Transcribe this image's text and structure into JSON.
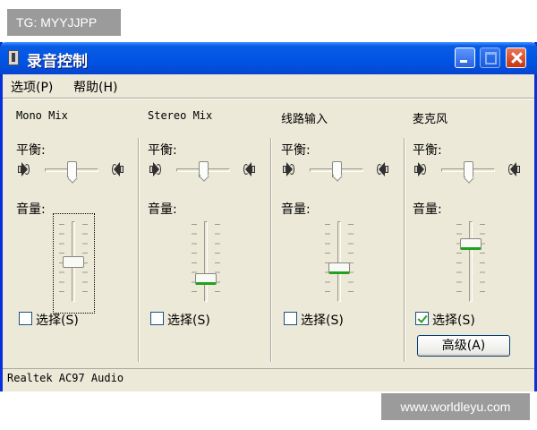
{
  "watermarks": {
    "top": "TG: MYYJJPP",
    "bottom": "www.worldleyu.com"
  },
  "window": {
    "title": "录音控制",
    "controls": [
      "minimize",
      "maximize",
      "close"
    ]
  },
  "menu": [
    {
      "label": "选项(P)"
    },
    {
      "label": "帮助(H)"
    }
  ],
  "labels": {
    "balance": "平衡:",
    "volume": "音量:",
    "select": "选择(S)",
    "advanced": "高级(A)"
  },
  "channels": [
    {
      "name": "Mono Mix",
      "balance": 0.5,
      "volume": 0.5,
      "selected": false
    },
    {
      "name": "Stereo Mix",
      "balance": 0.5,
      "volume": 0.25,
      "selected": false
    },
    {
      "name": "线路输入",
      "balance": 0.5,
      "volume": 0.4,
      "selected": false
    },
    {
      "name": "麦克风",
      "balance": 0.5,
      "volume": 0.75,
      "selected": true
    }
  ],
  "status": "Realtek AC97 Audio",
  "icons": [
    "app-icon",
    "speaker-left-icon",
    "speaker-right-icon",
    "check-icon"
  ]
}
